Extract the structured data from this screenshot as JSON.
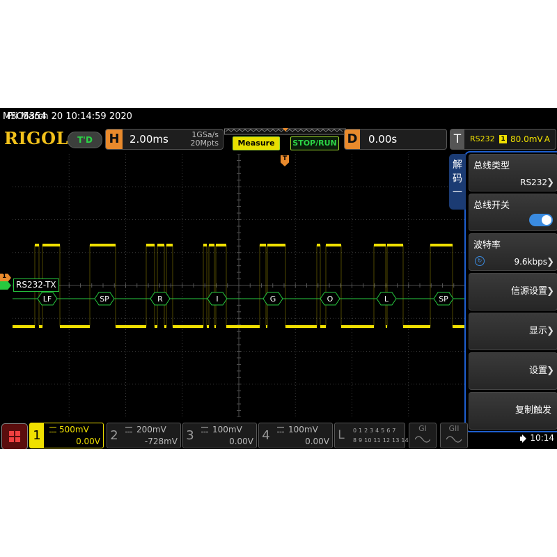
{
  "status": {
    "model": "MSO5354",
    "datetime": "Fri March 20 10:14:59 2020"
  },
  "header": {
    "brand": "RIGOL",
    "mode_pill": "T'D",
    "horizontal": {
      "letter": "H",
      "timebase": "2.00ms",
      "sample_rate": "1GSa/s",
      "memory_depth": "20Mpts"
    },
    "measure_label": "Measure",
    "run_label": "STOP/RUN",
    "delay": {
      "letter": "D",
      "value": "0.00s"
    },
    "trigger": {
      "letter": "T",
      "source": "RS232",
      "channel": "1",
      "level": "80.0mV",
      "mode": "A"
    }
  },
  "waveform": {
    "bus_label": "RS232-TX",
    "ground_marker": "1",
    "trigger_marker": "T",
    "decode_frames": [
      "LF",
      "SP",
      "R",
      "I",
      "G",
      "O",
      "L",
      "SP"
    ],
    "colors": {
      "channel1": "#f0e000",
      "bus": "#27c93f",
      "grid": "#3a3a3a"
    }
  },
  "sidemenu": {
    "tab_label": [
      "解",
      "码",
      "一"
    ],
    "items": [
      {
        "label": "总线类型",
        "value": "RS232"
      },
      {
        "label": "总线开关",
        "toggle": true
      },
      {
        "label": "波特率",
        "value": "9.6kbps"
      },
      {
        "label": "信源设置"
      },
      {
        "label": "显示"
      },
      {
        "label": "设置"
      },
      {
        "label": "复制触发"
      }
    ]
  },
  "channels": [
    {
      "num": "1",
      "scale": "500mV",
      "offset": "0.00V",
      "active": true
    },
    {
      "num": "2",
      "scale": "200mV",
      "offset": "-728mV",
      "active": false
    },
    {
      "num": "3",
      "scale": "100mV",
      "offset": "0.00V",
      "active": false
    },
    {
      "num": "4",
      "scale": "100mV",
      "offset": "0.00V",
      "active": false
    }
  ],
  "logic": {
    "letter": "L",
    "row1": "0 1 2 3 4 5 6 7",
    "row2": "8 9 10 11 12 13 14 15"
  },
  "generators": [
    {
      "label": "GI"
    },
    {
      "label": "GII"
    }
  ],
  "clock": "10:14"
}
